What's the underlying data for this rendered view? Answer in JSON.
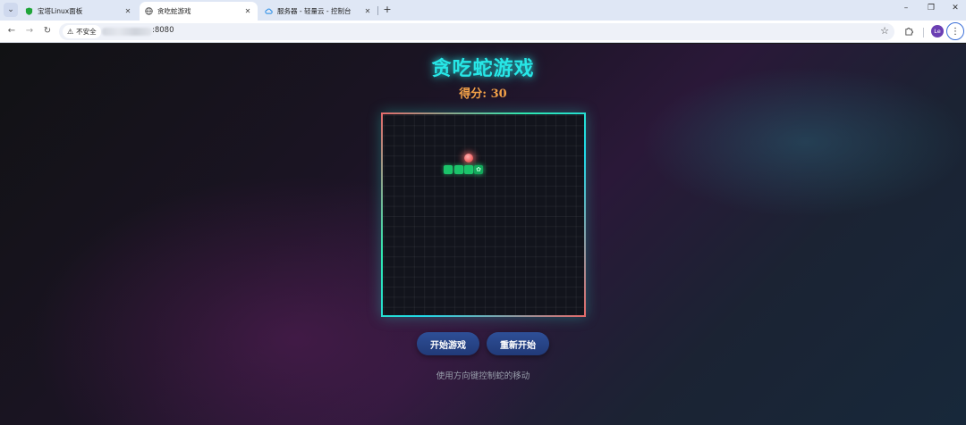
{
  "browser": {
    "tabs": [
      {
        "title": "宝塔Linux面板",
        "active": false
      },
      {
        "title": "贪吃蛇游戏",
        "active": true
      },
      {
        "title": "服务器 - 轻量云 - 控制台",
        "active": false
      }
    ],
    "new_tab_label": "+",
    "security_label": "不安全",
    "url_port": ":8080",
    "avatar_initials": "Le",
    "window_controls": [
      "–",
      "❐",
      "✕"
    ],
    "colors": {
      "tabbar": "#dfe7f5",
      "avatar": "#6b3fb3"
    }
  },
  "game": {
    "title": "贪吃蛇游戏",
    "score_label": "得分: 30",
    "start_button": "开始游戏",
    "restart_button": "重新开始",
    "hint": "使用方向键控制蛇的移动",
    "head_glyph": "✿",
    "colors": {
      "title": "#27e6e6",
      "score": "#f2a148",
      "snake": "#1bc46a",
      "food": "#ef5b5b",
      "button": "#2e4f97"
    }
  }
}
